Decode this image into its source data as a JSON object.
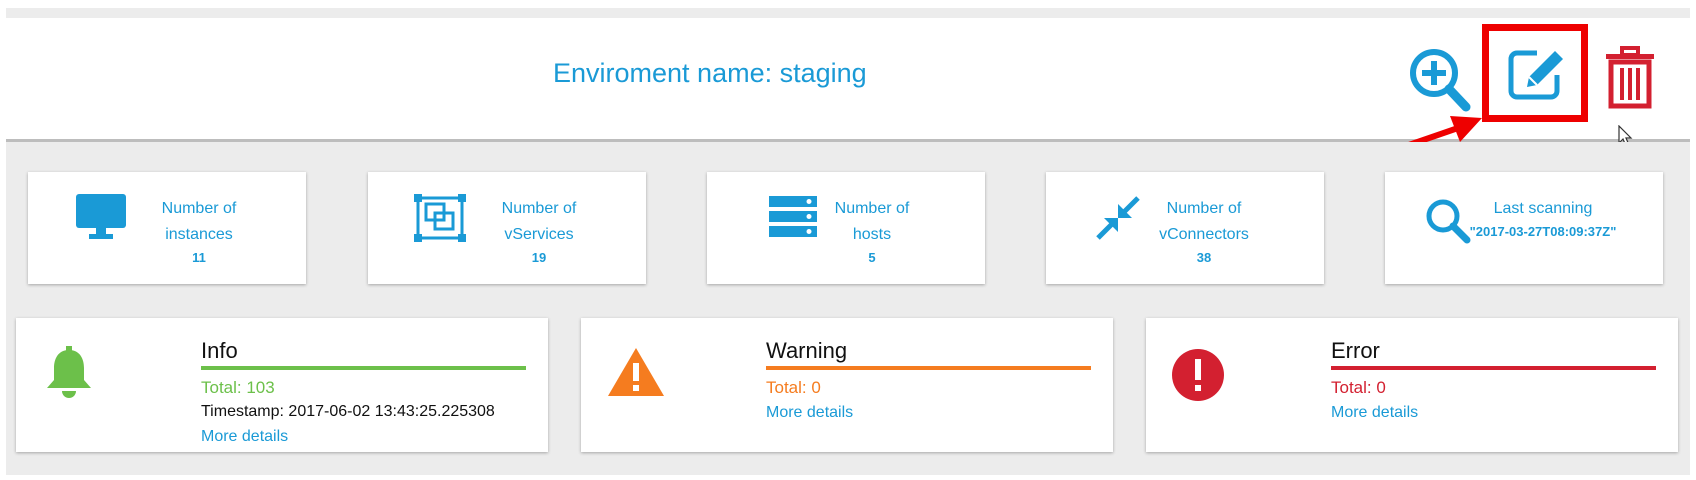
{
  "header": {
    "title": "Enviroment name: staging"
  },
  "toolbar": {
    "zoom_icon": "zoom-in-icon",
    "edit_icon": "edit-icon",
    "delete_icon": "trash-icon"
  },
  "colors": {
    "blue": "#1a9ad6",
    "red_highlight": "#ee0000",
    "delete_red": "#d32030",
    "info_green": "#6cc04a",
    "warning_orange": "#f57c1f",
    "error_red": "#d32030"
  },
  "stats": [
    {
      "icon": "monitor-icon",
      "label1": "Number of",
      "label2": "instances",
      "value": "11"
    },
    {
      "icon": "vservices-icon",
      "label1": "Number of",
      "label2": "vServices",
      "value": "19"
    },
    {
      "icon": "hosts-icon",
      "label1": "Number of",
      "label2": "hosts",
      "value": "5"
    },
    {
      "icon": "compress-icon",
      "label1": "Number of",
      "label2": "vConnectors",
      "value": "38"
    },
    {
      "icon": "search-icon",
      "label1": "Last scanning",
      "label2": "\"2017-03-27T08:09:37Z\""
    }
  ],
  "alerts": {
    "info": {
      "title": "Info",
      "total": "Total: 103",
      "timestamp": "Timestamp: 2017-06-02 13:43:25.225308",
      "link": "More details"
    },
    "warning": {
      "title": "Warning",
      "total": "Total: 0",
      "link": "More details"
    },
    "error": {
      "title": "Error",
      "total": "Total: 0",
      "link": "More details"
    }
  }
}
